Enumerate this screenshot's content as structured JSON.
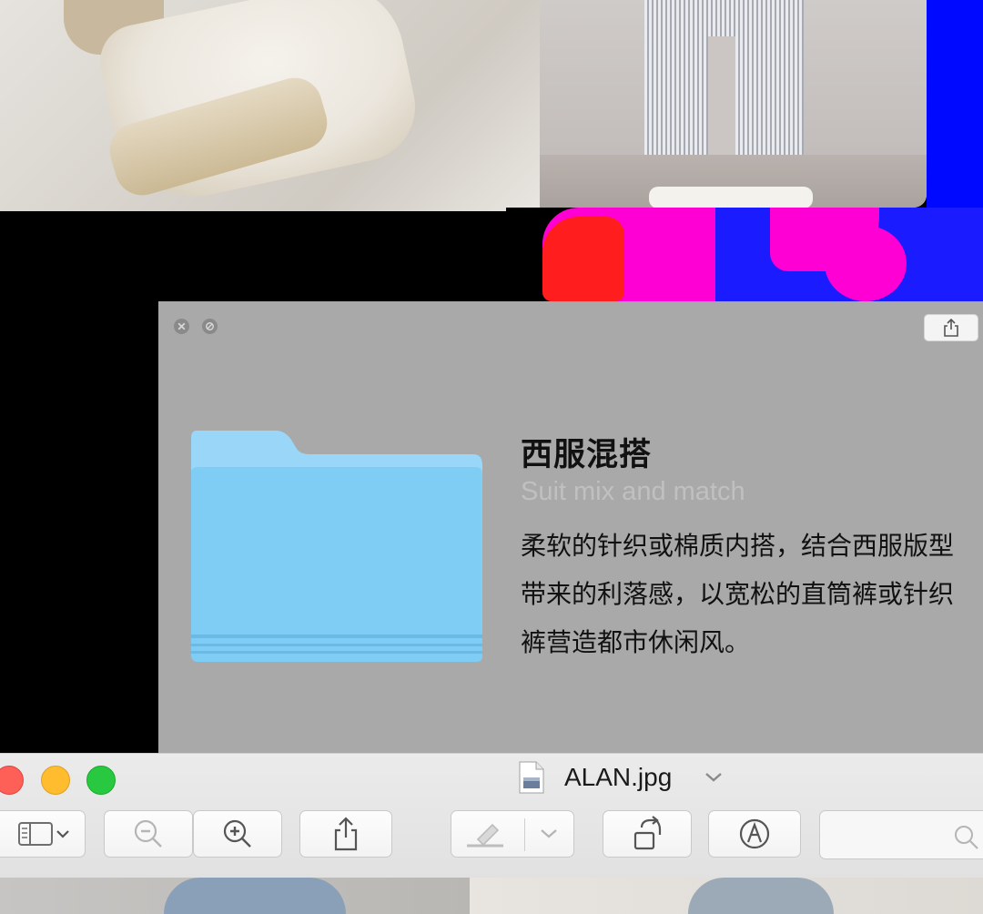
{
  "quicklook": {
    "title": "西服混搭",
    "subtitle": "Suit mix and match",
    "description": "柔软的针织或棉质内搭，结合西服版型带来的利落感，以宽松的直筒裤或针织裤营造都市休闲风。"
  },
  "preview": {
    "filename": "ALAN.jpg",
    "toolbar": [
      "sidebar-toggle",
      "zoom-out",
      "zoom-in",
      "share",
      "markup-pen",
      "rotate",
      "annotate",
      "search"
    ]
  },
  "colors": {
    "accent_folder": "#7fcdf4",
    "panel_bg": "#a9a9a9",
    "close": "#fe5f57",
    "minimize": "#febc2e",
    "maximize": "#28c840"
  }
}
